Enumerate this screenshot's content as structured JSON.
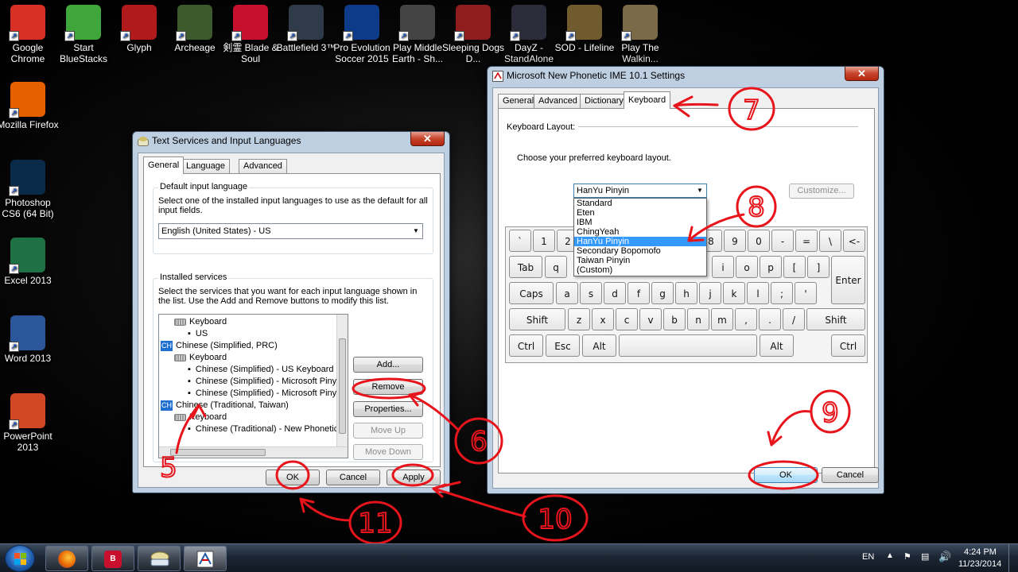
{
  "desktop": {
    "icons_top": [
      {
        "label": "Google Chrome",
        "icon": "chrome-icon",
        "color": "#d93025"
      },
      {
        "label": "Start BlueStacks",
        "icon": "bluestacks-icon",
        "color": "#3fa63c"
      },
      {
        "label": "Glyph",
        "icon": "glyph-icon",
        "color": "#b11a1a"
      },
      {
        "label": "Archeage",
        "icon": "archeage-icon",
        "color": "#3d5a2c"
      },
      {
        "label": "剣霊 Blade & Soul",
        "icon": "blade-soul-icon",
        "color": "#c8102e"
      },
      {
        "label": "Battlefield 3™",
        "icon": "battlefield-icon",
        "color": "#2f3b48"
      },
      {
        "label": "Pro Evolution Soccer 2015",
        "icon": "pes-icon",
        "color": "#0e3a8a"
      },
      {
        "label": "Play Middle Earth - Sh...",
        "icon": "middle-earth-icon",
        "color": "#444444"
      },
      {
        "label": "Sleeping Dogs D...",
        "icon": "sleeping-dogs-icon",
        "color": "#8f1d1d"
      },
      {
        "label": "DayZ - StandAlone",
        "icon": "dayz-icon",
        "color": "#2b2b3a"
      },
      {
        "label": "SOD - Lifeline",
        "icon": "sod-icon",
        "color": "#6f5b2d"
      },
      {
        "label": "Play The Walkin...",
        "icon": "walking-dead-icon",
        "color": "#7b6a48"
      }
    ],
    "icons_left": [
      {
        "label": "Mozilla Firefox",
        "icon": "firefox-icon",
        "color": "#e66000"
      },
      {
        "label": "Photoshop CS6 (64 Bit)",
        "icon": "photoshop-icon",
        "color": "#0a2a4a"
      },
      {
        "label": "Excel 2013",
        "icon": "excel-icon",
        "color": "#1e7145"
      },
      {
        "label": "Word 2013",
        "icon": "word-icon",
        "color": "#2b579a"
      },
      {
        "label": "PowerPoint 2013",
        "icon": "powerpoint-icon",
        "color": "#d24726"
      }
    ]
  },
  "tsil_window": {
    "title": "Text Services and Input Languages",
    "tabs": [
      "General",
      "Language Bar",
      "Advanced Key Settings"
    ],
    "default_group": {
      "title": "Default input language",
      "description": "Select one of the installed input languages to use as the default for all input fields.",
      "selected": "English (United States) - US"
    },
    "installed_group": {
      "title": "Installed services",
      "description": "Select the services that you want for each input language shown in the list. Use the Add and Remove buttons to modify this list."
    },
    "tree": [
      {
        "text": "Keyboard",
        "indent": 1,
        "kind": "keyboard"
      },
      {
        "text": "US",
        "indent": 2,
        "kind": "bullet"
      },
      {
        "text": "Chinese (Simplified, PRC)",
        "indent": 0,
        "kind": "lang",
        "badge": "CH"
      },
      {
        "text": "Keyboard",
        "indent": 1,
        "kind": "keyboard"
      },
      {
        "text": "Chinese (Simplified) - US Keyboard",
        "indent": 2,
        "kind": "bullet"
      },
      {
        "text": "Chinese (Simplified) - Microsoft Pinyin",
        "indent": 2,
        "kind": "bullet"
      },
      {
        "text": "Chinese (Simplified) - Microsoft Pinyin",
        "indent": 2,
        "kind": "bullet"
      },
      {
        "text": "Chinese (Traditional, Taiwan)",
        "indent": 0,
        "kind": "lang",
        "badge": "CH"
      },
      {
        "text": "Keyboard",
        "indent": 1,
        "kind": "keyboard"
      },
      {
        "text": "Chinese (Traditional) - New Phonetic",
        "indent": 2,
        "kind": "bullet"
      }
    ],
    "buttons": {
      "add": "Add...",
      "remove": "Remove",
      "properties": "Properties...",
      "move_up": "Move Up",
      "move_down": "Move Down",
      "ok": "OK",
      "cancel": "Cancel",
      "apply": "Apply"
    }
  },
  "ime_window": {
    "title": "Microsoft New Phonetic IME 10.1 Settings",
    "tabs": [
      "General",
      "Advanced",
      "Dictionary",
      "Keyboard"
    ],
    "layout_label": "Keyboard Layout:",
    "instruction": "Choose your preferred keyboard layout.",
    "selected_layout": "HanYu Pinyin",
    "customize": "Customize...",
    "options": [
      "Standard",
      "Eten",
      "IBM",
      "ChingYeah",
      "HanYu Pinyin",
      "Secondary Bopomofo",
      "Taiwan Pinyin",
      "(Custom)"
    ],
    "keys_row1": [
      "`",
      "1",
      "2",
      "8",
      "9",
      "0",
      "-",
      "=",
      "\\",
      "<-"
    ],
    "keys_row2": [
      "Tab",
      "q",
      "i",
      "o",
      "p",
      "[",
      "]",
      "Enter"
    ],
    "keys_row3": [
      "Caps",
      "a",
      "s",
      "d",
      "f",
      "g",
      "h",
      "j",
      "k",
      "l",
      ";",
      "'"
    ],
    "keys_row4": [
      "Shift",
      "z",
      "x",
      "c",
      "v",
      "b",
      "n",
      "m",
      ",",
      ".",
      "/",
      "Shift"
    ],
    "keys_row5": [
      "Ctrl",
      "Esc",
      "Alt",
      "Alt",
      "Ctrl"
    ],
    "ok": "OK",
    "cancel": "Cancel"
  },
  "annotations": [
    "5",
    "6",
    "7",
    "8",
    "9",
    "10",
    "11"
  ],
  "annotation_color": "#e8141c",
  "taskbar": {
    "lang": "EN",
    "time": "4:24 PM",
    "date": "11/23/2014"
  }
}
